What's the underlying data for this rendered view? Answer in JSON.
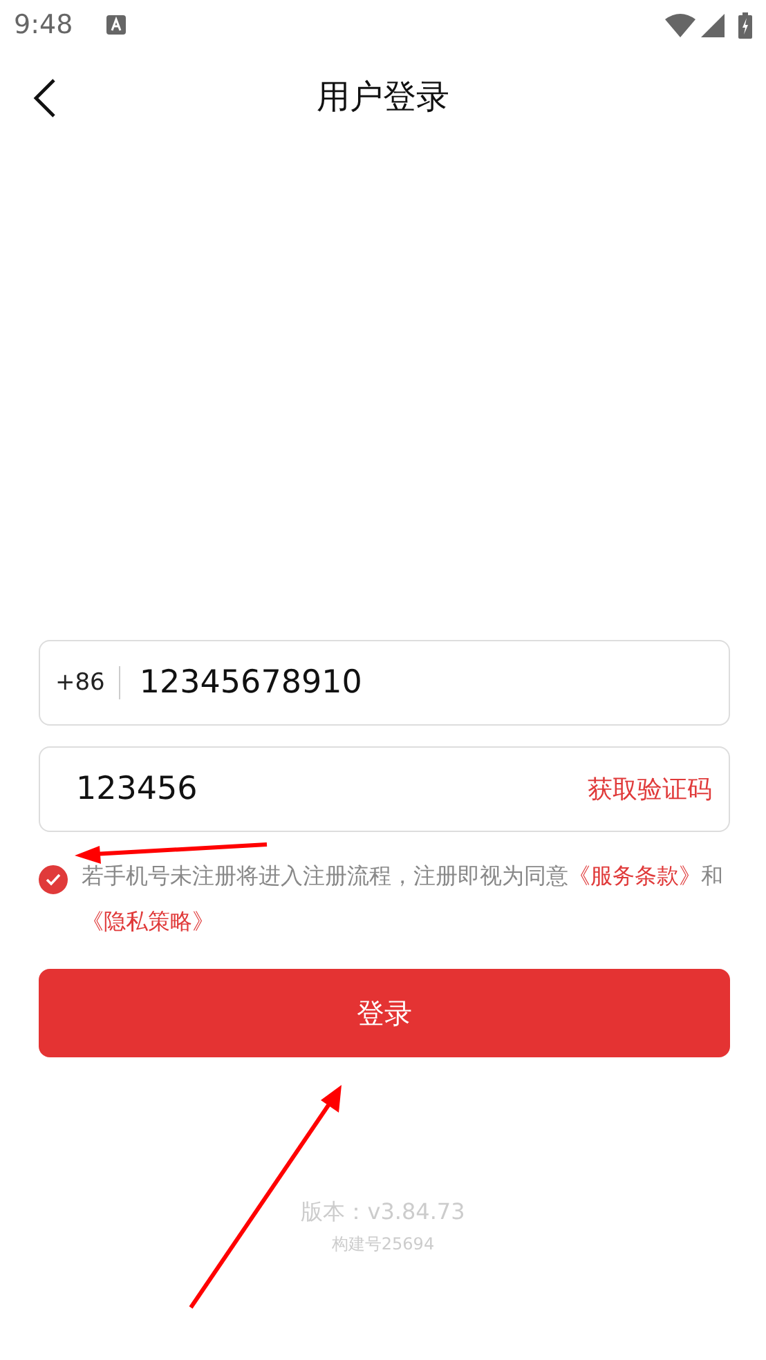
{
  "status_bar": {
    "time": "9:48"
  },
  "header": {
    "title": "用户登录"
  },
  "phone_field": {
    "country_code": "+86",
    "value": "12345678910"
  },
  "code_field": {
    "value": "123456",
    "action": "获取验证码"
  },
  "agreement": {
    "checked": true,
    "parts": [
      {
        "kind": "text",
        "text": "若手机号未注册将进入注册流程，注册即视为同意"
      },
      {
        "kind": "link",
        "text": "《服务条款》"
      },
      {
        "kind": "text",
        "text": "和"
      },
      {
        "kind": "link",
        "text": "《隐私策略》"
      }
    ]
  },
  "login_button": {
    "label": "登录"
  },
  "footer": {
    "version": "版本：v3.84.73",
    "build": "构建号25694"
  }
}
